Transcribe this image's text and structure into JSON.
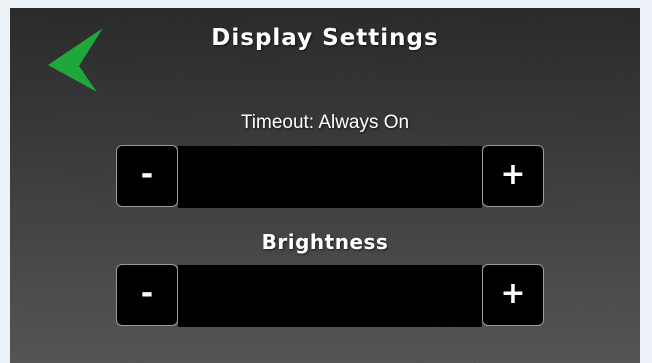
{
  "header": {
    "title": "Display Settings",
    "back_icon": "chevron-left-icon",
    "back_color": "#1fa83a"
  },
  "timeout": {
    "label": "Timeout: Always On",
    "minus_label": "-",
    "plus_label": "+"
  },
  "brightness": {
    "label": "Brightness",
    "minus_label": "-",
    "plus_label": "+"
  }
}
